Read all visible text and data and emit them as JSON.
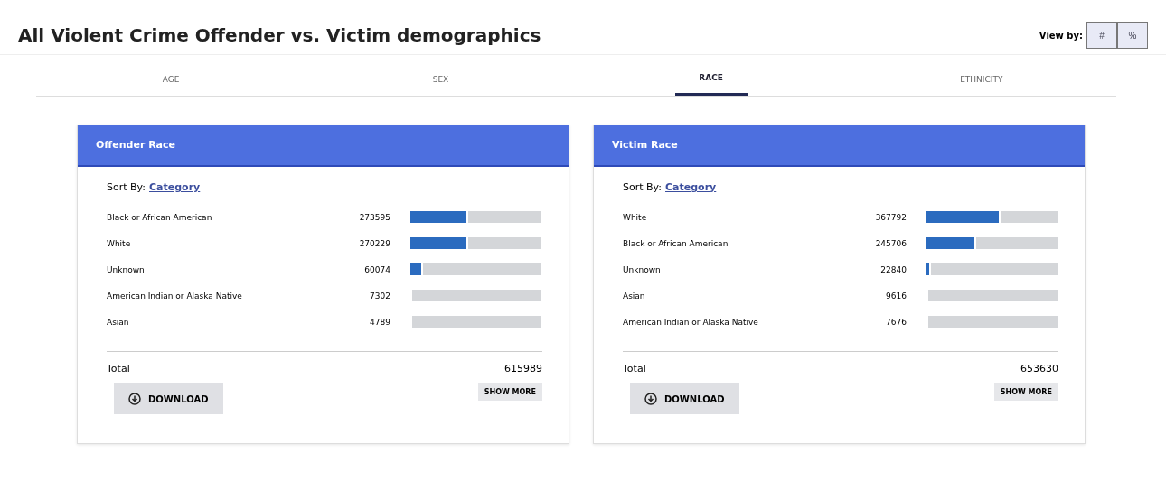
{
  "title": "All Violent Crime Offender vs. Victim demographics",
  "view_by": {
    "label": "View by:",
    "options": [
      "#",
      "%"
    ]
  },
  "tabs": [
    {
      "label": "AGE",
      "selected": false
    },
    {
      "label": "SEX",
      "selected": false
    },
    {
      "label": "RACE",
      "selected": true
    },
    {
      "label": "ETHNICITY",
      "selected": false
    }
  ],
  "panels": [
    {
      "title": "Offender Race",
      "sort_label": "Sort By:",
      "sort_link": "Category",
      "rows": [
        {
          "name": "Black or African American",
          "count": "273595",
          "level": 0.444
        },
        {
          "name": "White",
          "count": "270229",
          "level": 0.439
        },
        {
          "name": "Unknown",
          "count": "60074",
          "level": 0.098
        },
        {
          "name": "American Indian or Alaska Native",
          "count": "7302",
          "level": 0.012
        },
        {
          "name": "Asian",
          "count": "4789",
          "level": 0.008
        }
      ],
      "total_label": "Total",
      "total": "615989",
      "show_more": "SHOW MORE",
      "download": "DOWNLOAD"
    },
    {
      "title": "Victim Race",
      "sort_label": "Sort By:",
      "sort_link": "Category",
      "rows": [
        {
          "name": "White",
          "count": "367792",
          "level": 0.563
        },
        {
          "name": "Black or African American",
          "count": "245706",
          "level": 0.376
        },
        {
          "name": "Unknown",
          "count": "22840",
          "level": 0.035
        },
        {
          "name": "Asian",
          "count": "9616",
          "level": 0.015
        },
        {
          "name": "American Indian or Alaska Native",
          "count": "7676",
          "level": 0.012
        }
      ],
      "total_label": "Total",
      "total": "653630",
      "show_more": "SHOW MORE",
      "download": "DOWNLOAD"
    }
  ]
}
